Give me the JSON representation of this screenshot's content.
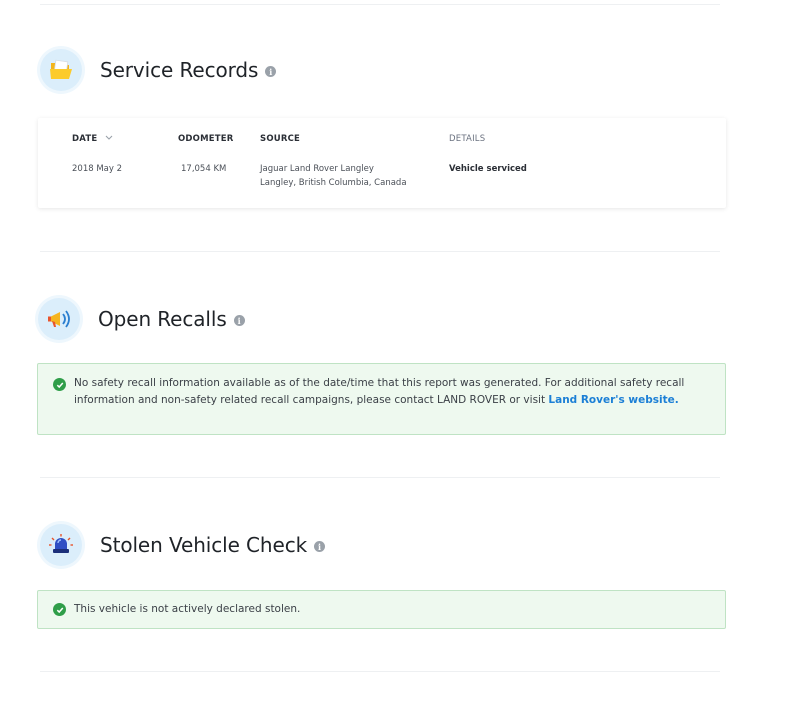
{
  "service_records": {
    "title": "Service Records",
    "columns": {
      "date": "DATE",
      "odometer": "ODOMETER",
      "source": "SOURCE",
      "details": "DETAILS"
    },
    "rows": [
      {
        "date": "2018 May 2",
        "odometer": "17,054 KM",
        "source_line1": "Jaguar Land Rover Langley",
        "source_line2": "Langley, British Columbia, Canada",
        "details": "Vehicle serviced"
      }
    ]
  },
  "open_recalls": {
    "title": "Open Recalls",
    "message": "No safety recall information available as of the date/time that this report was generated. For additional safety recall information and non-safety related recall campaigns, please contact LAND ROVER or visit ",
    "link_text": "Land Rover's website."
  },
  "stolen_vehicle": {
    "title": "Stolen Vehicle Check",
    "message": "This vehicle is not actively declared stolen."
  },
  "icons": {
    "service": "folder-icon",
    "recalls": "megaphone-icon",
    "stolen": "police-siren-icon",
    "info": "info-icon",
    "check": "check-circle-icon",
    "sort": "chevron-down-icon"
  },
  "colors": {
    "success_bg": "#eef9ef",
    "success_border": "#bfe3c4",
    "success_icon": "#2f9e49",
    "link": "#1b7fd6",
    "icon_bg": "#dbeefb"
  }
}
